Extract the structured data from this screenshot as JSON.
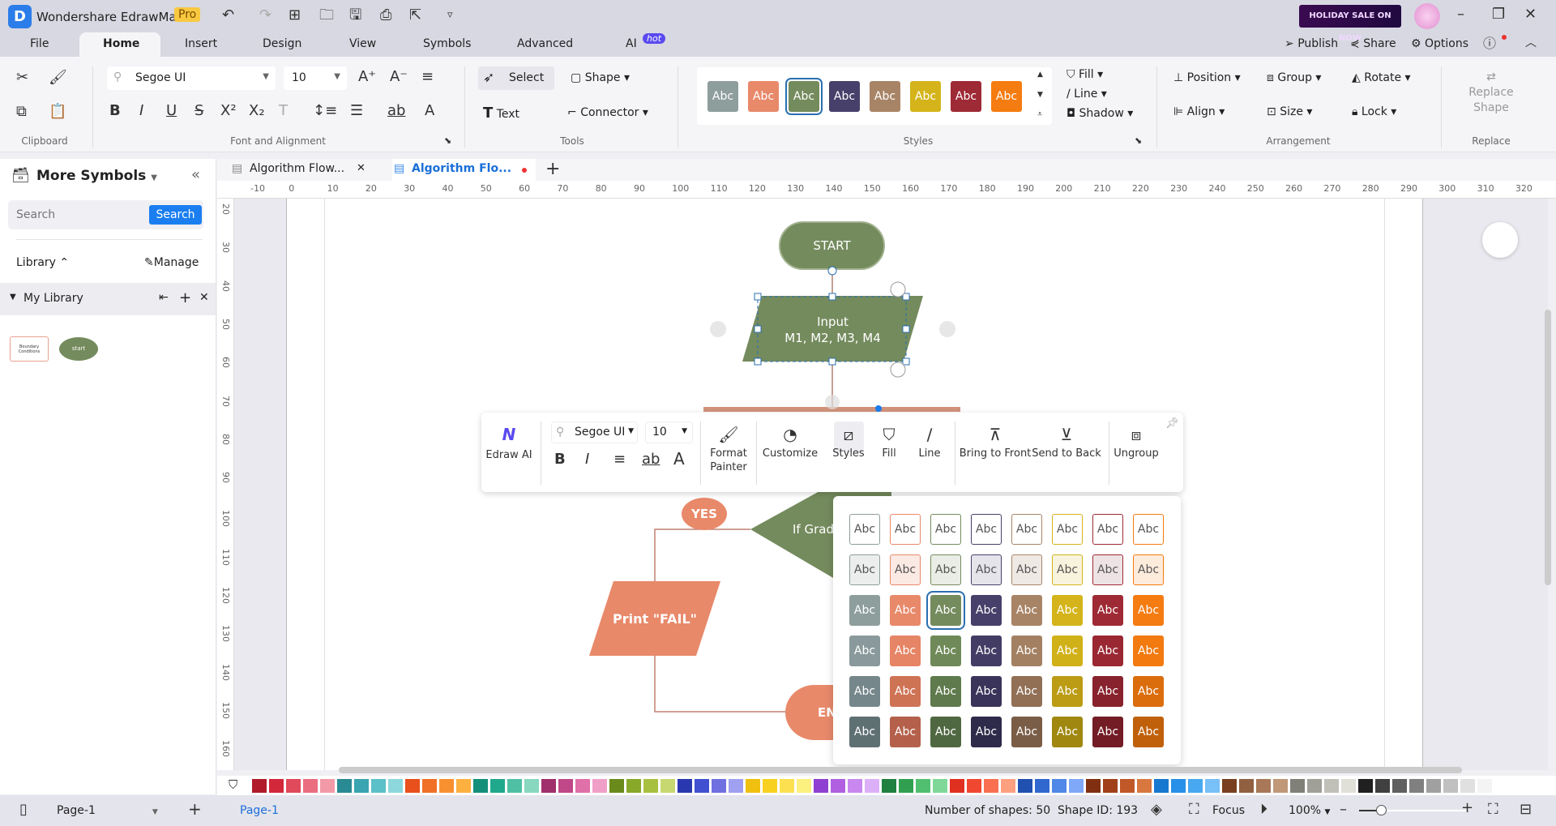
{
  "app": {
    "title": "Wondershare EdrawMax",
    "badge": "Pro",
    "promo": "HOLIDAY SALE ON NOW"
  },
  "menu_tabs": [
    {
      "label": "File"
    },
    {
      "label": "Home"
    },
    {
      "label": "Insert"
    },
    {
      "label": "Design"
    },
    {
      "label": "View"
    },
    {
      "label": "Symbols"
    },
    {
      "label": "Advanced"
    },
    {
      "label": "AI"
    }
  ],
  "ai_badge": "hot",
  "top_right": {
    "publish": "Publish",
    "share": "Share",
    "options": "Options"
  },
  "ribbon": {
    "font": "Segoe UI",
    "size": "10",
    "groups": {
      "clipboard": "Clipboard",
      "font": "Font and Alignment",
      "tools": "Tools",
      "styles": "Styles",
      "arrangement": "Arrangement",
      "replace": "Replace"
    },
    "tools": {
      "select": "Select",
      "shape": "Shape",
      "text": "Text",
      "connector": "Connector"
    },
    "style_swatches": [
      "#8e9e9c",
      "#e8896a",
      "#748b5d",
      "#46406a",
      "#a88466",
      "#d4b41a",
      "#9e2a35",
      "#f57c10"
    ],
    "swatch_text": "Abc",
    "fill": "Fill",
    "line": "Line",
    "shadow": "Shadow",
    "position": "Position",
    "align": "Align",
    "group": "Group",
    "size_btn": "Size",
    "rotate": "Rotate",
    "lock": "Lock",
    "replace_shape_1": "Replace",
    "replace_shape_2": "Shape"
  },
  "left_panel": {
    "title": "More Symbols",
    "search_placeholder": "Search",
    "search_button": "Search",
    "library": "Library",
    "manage": "Manage",
    "my_library": "My Library",
    "thumb1": "Boundary Conditions",
    "thumb2": "start"
  },
  "doc_tabs": [
    {
      "label": "Algorithm Flow..."
    },
    {
      "label": "Algorithm Flo..."
    }
  ],
  "ruler": {
    "h": [
      "-10",
      "0",
      "10",
      "20",
      "30",
      "40",
      "50",
      "60",
      "70",
      "80",
      "90",
      "100",
      "110",
      "120",
      "130",
      "140",
      "150",
      "160",
      "170",
      "180",
      "190",
      "200",
      "210",
      "220",
      "230",
      "240",
      "250",
      "260",
      "270",
      "280",
      "290",
      "300",
      "310",
      "320"
    ],
    "v": [
      "20",
      "30",
      "40",
      "50",
      "60",
      "70",
      "80",
      "90",
      "100",
      "110",
      "120",
      "130",
      "140",
      "150",
      "160"
    ]
  },
  "diagram": {
    "start": "START",
    "input_1": "Input",
    "input_2": "M1, M2, M3, M4",
    "yes": "YES",
    "decision": "If Grad",
    "print_fail": "Print \"FAIL\"",
    "end": "EN",
    "colors": {
      "green": "#748b5d",
      "orange": "#e8896a"
    }
  },
  "float_toolbar": {
    "edraw_ai": "Edraw AI",
    "font": "Segoe UI",
    "size": "10",
    "format_painter_1": "Format",
    "format_painter_2": "Painter",
    "customize": "Customize",
    "styles": "Styles",
    "fill": "Fill",
    "line": "Line",
    "bring_front": "Bring to Front",
    "send_back": "Send to Back",
    "ungroup": "Ungroup"
  },
  "style_popup": {
    "label": "Abc",
    "base_colors": [
      "#8e9e9c",
      "#e8896a",
      "#748b5d",
      "#46406a",
      "#a88466",
      "#d4b41a",
      "#9e2a35",
      "#f57c10"
    ],
    "rows": [
      {
        "bg": [
          "#ffffff",
          "#ffffff",
          "#ffffff",
          "#ffffff",
          "#ffffff",
          "#ffffff",
          "#ffffff",
          "#ffffff"
        ],
        "fg": "dark"
      },
      {
        "bg": [
          "#eceeee",
          "#fbe9e3",
          "#e9ede5",
          "#e5e4eb",
          "#efe9e4",
          "#f8f3dc",
          "#eee3e4",
          "#fdebdc"
        ],
        "fg": "dark"
      },
      {
        "bg": [
          "#8e9e9c",
          "#e8896a",
          "#748b5d",
          "#46406a",
          "#a88466",
          "#d4b41a",
          "#9e2a35",
          "#f57c10"
        ],
        "fg": "light"
      },
      {
        "bg": [
          "#8a9a9c",
          "#e58565",
          "#6f8a58",
          "#433d66",
          "#a38062",
          "#d1b118",
          "#9a2832",
          "#f27a0e"
        ],
        "fg": "light"
      },
      {
        "bg": [
          "#75878a",
          "#cf7355",
          "#5f7a4c",
          "#3a345a",
          "#917056",
          "#bb9c14",
          "#88222c",
          "#db6d0c"
        ],
        "fg": "light"
      },
      {
        "bg": [
          "#5f7073",
          "#b4604a",
          "#506841",
          "#2e2a4a",
          "#7a5d47",
          "#a08810",
          "#731c25",
          "#c0600a"
        ],
        "fg": "light"
      }
    ],
    "selected": [
      2,
      2
    ]
  },
  "color_palette": [
    "#b01c2a",
    "#d2283a",
    "#e04a5a",
    "#ea6e80",
    "#f29aa8",
    "#2a8a94",
    "#3aa4b0",
    "#5cc0c8",
    "#8cd8dc",
    "#e8501c",
    "#f07028",
    "#f89030",
    "#fcb040",
    "#14907a",
    "#20a88c",
    "#50c0a4",
    "#88d8c0",
    "#a0306c",
    "#c04888",
    "#e070a8",
    "#f0a0c8",
    "#6a8a1c",
    "#88a82a",
    "#a8c040",
    "#c8d870",
    "#2a38b0",
    "#4050d0",
    "#7070e0",
    "#a0a0f0",
    "#f0c010",
    "#f8d020",
    "#fce050",
    "#fcf080",
    "#9040d0",
    "#b060e0",
    "#c888f0",
    "#dcb0f8",
    "#208040",
    "#30a050",
    "#50c070",
    "#80d898",
    "#e03020",
    "#f04830",
    "#f87050",
    "#fca080",
    "#2050b0",
    "#3068d0",
    "#5088e8",
    "#80a8f8",
    "#803010",
    "#a04018",
    "#c05828",
    "#d87840",
    "#1878d0",
    "#2890e8",
    "#48a8f0",
    "#78c0f8",
    "#784020",
    "#906040",
    "#a87858",
    "#c09878",
    "#808078",
    "#a0a098",
    "#c0c0b8",
    "#e0e0d8",
    "#202020",
    "#404040",
    "#606060",
    "#808080",
    "#a0a0a0",
    "#c0c0c0",
    "#e0e0e0",
    "#f4f4f4"
  ],
  "status": {
    "page_select": "Page-1",
    "page_tab": "Page-1",
    "shapes": "Number of shapes: 50",
    "shape_id": "Shape ID: 193",
    "focus": "Focus",
    "zoom": "100%",
    "zoom_level": 0.2
  }
}
